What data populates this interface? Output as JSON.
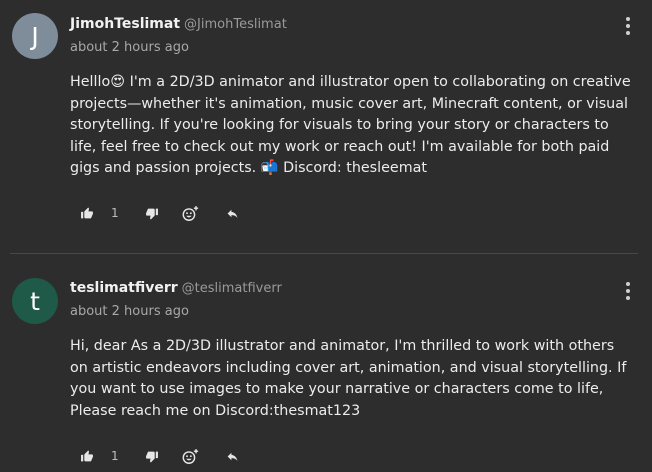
{
  "comments": [
    {
      "avatar_letter": "J",
      "avatar_color": "#7f8c99",
      "display_name": "JimohTeslimat",
      "handle": "@JimohTeslimat",
      "timestamp": "about 2 hours ago",
      "body": "Helllo😍 I'm a 2D/3D animator and illustrator open to collaborating on creative projects—whether it's animation, music cover art, Minecraft content, or visual storytelling. If you're looking for visuals to bring your story or characters to life, feel free to check out my work or reach out! I'm available for both paid gigs and passion projects. 📬 Discord: thesleemat",
      "like_count": "1"
    },
    {
      "avatar_letter": "t",
      "avatar_color": "#1e5a47",
      "display_name": "teslimatfiverr",
      "handle": "@teslimatfiverr",
      "timestamp": "about 2 hours ago",
      "body": "Hi, dear As a 2D/3D illustrator and animator, I'm thrilled to work with others on artistic endeavors including cover art, animation, and visual storytelling. If you want to use images to make your narrative or characters come to life,\nPlease reach me on Discord:thesmat123",
      "like_count": "1"
    }
  ],
  "icons": {
    "like": "thumbs-up-icon",
    "dislike": "thumbs-down-icon",
    "react": "add-reaction-icon",
    "reply": "reply-icon",
    "menu": "more-vertical-icon"
  },
  "colors": {
    "background": "#2d2d2d",
    "divider": "#484848",
    "text": "#ececec",
    "muted": "#a8a8a8"
  }
}
